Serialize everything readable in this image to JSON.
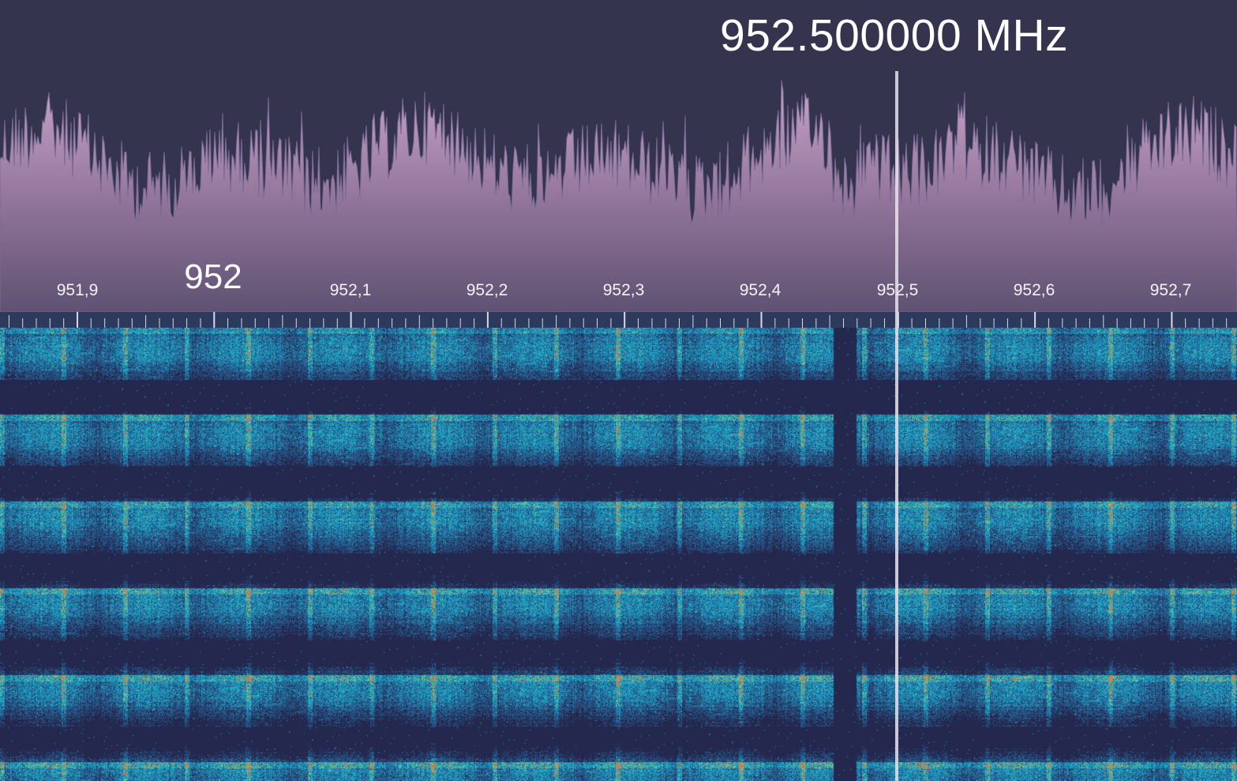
{
  "tuner": {
    "frequency_readout": "952.500000 MHz",
    "major_label": "952",
    "axis_labels": [
      "951,9",
      "952,1",
      "952,2",
      "952,3",
      "952,4",
      "952,5",
      "952,6",
      "952,7"
    ]
  },
  "colors": {
    "background": "#34344f",
    "spectrum_fill_top": "#c9a4c8",
    "spectrum_fill_bottom": "#5e5273",
    "waterfall_background": "#262a4e",
    "tuning_line": "#e8e4ec",
    "label_text": "#ffffff"
  }
}
